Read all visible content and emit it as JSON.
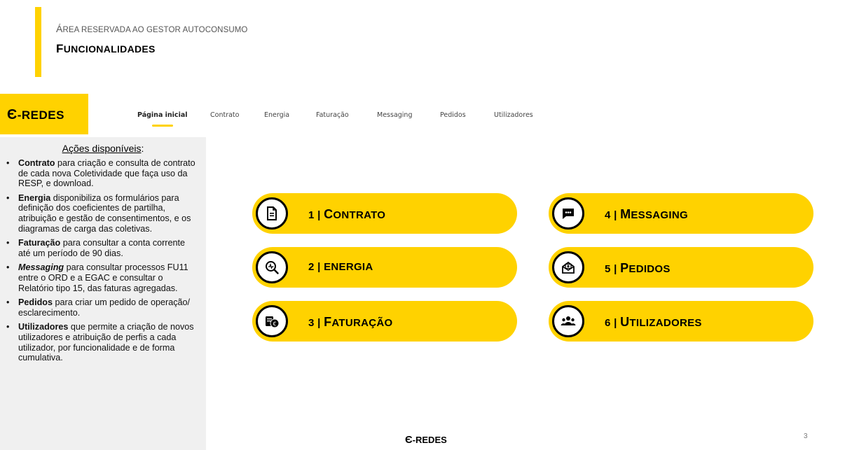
{
  "header": {
    "area_first": "Á",
    "area_rest": "REA RESERVADA AO GESTOR AUTOCONSUMO",
    "title_first": "F",
    "title_rest": "UNCIONALIDADES",
    "accent_color": "#FFD200"
  },
  "logo": {
    "e": "Є",
    "text": "-REDES"
  },
  "nav": {
    "items": [
      {
        "label": "Página inicial",
        "active": true
      },
      {
        "label": "Contrato"
      },
      {
        "label": "Energia"
      },
      {
        "label": "Faturação"
      },
      {
        "label": "Messaging"
      },
      {
        "label": "Pedidos"
      },
      {
        "label": "Utilizadores"
      }
    ]
  },
  "sidebar": {
    "title": "Ações disponíveis",
    "title_suffix": ":",
    "items": [
      {
        "bold": "Contrato",
        "text": " para criação e consulta de contrato de cada nova Coletividade que faça uso da RESP, e download."
      },
      {
        "bold": "Energia",
        "text": " disponibiliza os formulários para definição dos coeficientes de partilha, atribuição e gestão de consentimentos, e os diagramas de carga das coletivas."
      },
      {
        "bold": "Faturação",
        "text": " para consultar a conta corrente até um período de 90 dias."
      },
      {
        "bold": "Messaging",
        "text": " para consultar processos FU11 entre o ORD e a EGAC e consultar  o Relatório tipo 15, das faturas agregadas."
      },
      {
        "bold": "Pedidos",
        "text": " para criar um pedido de operação/ esclarecimento."
      },
      {
        "bold": "Utilizadores",
        "text": " que permite a criação de novos utilizadores e  atribuição de perfis a cada utilizador, por funcionalidade e de forma cumulativa."
      }
    ]
  },
  "tiles": [
    {
      "prefix": "1 | ",
      "first": "C",
      "rest": "ONTRATO",
      "icon": "document-icon"
    },
    {
      "prefix": "2 | ",
      "first": "E",
      "rest": "NERGIA",
      "icon": "energy-search-icon"
    },
    {
      "prefix": "3 | ",
      "first": "F",
      "rest": "ATURAÇÃO",
      "icon": "billing-coins-icon"
    },
    {
      "prefix": "4 | ",
      "first": "M",
      "rest": "ESSAGING",
      "icon": "chat-message-icon"
    },
    {
      "prefix": "5 | ",
      "first": "P",
      "rest": "EDIDOS",
      "icon": "request-envelope-icon"
    },
    {
      "prefix": "6 | ",
      "first": "U",
      "rest": "TILIZADORES",
      "icon": "users-group-icon"
    }
  ],
  "footer": {
    "logo_e": "Є",
    "logo_text": "-REDES",
    "page_number": "3"
  }
}
